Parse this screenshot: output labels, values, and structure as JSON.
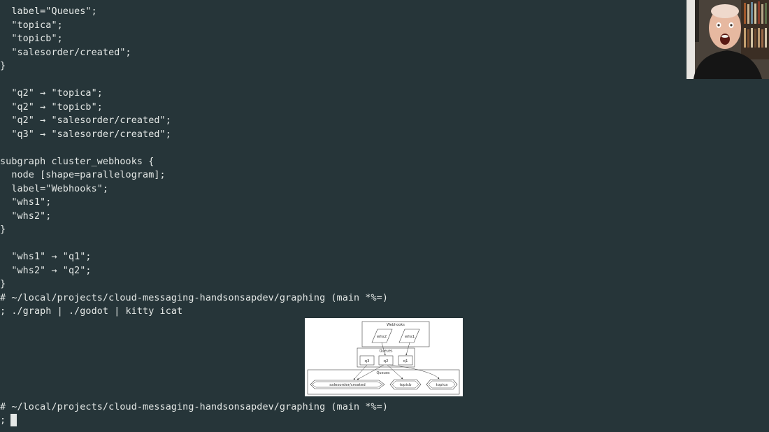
{
  "terminal": {
    "lines": [
      "  label=\"Queues\";",
      "  \"topica\";",
      "  \"topicb\";",
      "  \"salesorder/created\";",
      "}",
      "",
      "  \"q2\" → \"topica\";",
      "  \"q2\" → \"topicb\";",
      "  \"q2\" → \"salesorder/created\";",
      "  \"q3\" → \"salesorder/created\";",
      "",
      "subgraph cluster_webhooks {",
      "  node [shape=parallelogram];",
      "  label=\"Webhooks\";",
      "  \"whs1\";",
      "  \"whs2\";",
      "}",
      "",
      "  \"whs1\" → \"q1\";",
      "  \"whs2\" → \"q2\";",
      "}",
      "# ~/local/projects/cloud-messaging-handsonsapdev/graphing (main *%=)",
      "; ./graph | ./godot | kitty icat"
    ],
    "prompt_after": "# ~/local/projects/cloud-messaging-handsonsapdev/graphing (main *%=)",
    "input_prompt": ";"
  },
  "graph_image": {
    "clusters": {
      "webhooks": "Webhooks",
      "queues": "Queues",
      "topics": "Queues"
    },
    "webhook_nodes": [
      "whs2",
      "whs1"
    ],
    "queue_nodes": [
      "q3",
      "q2",
      "q1"
    ],
    "topic_nodes": [
      "salesorder/created",
      "topicb",
      "topica"
    ]
  },
  "colors": {
    "background": "#263539",
    "foreground": "#e4e8e6"
  }
}
